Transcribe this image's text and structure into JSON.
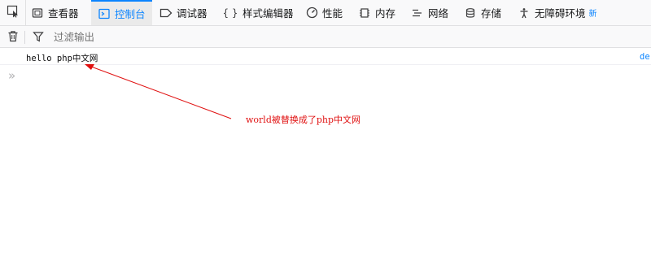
{
  "tabs": [
    {
      "label": "查看器",
      "icon": "inspector-icon"
    },
    {
      "label": "控制台",
      "icon": "console-icon",
      "selected": true
    },
    {
      "label": "调试器",
      "icon": "debugger-icon"
    },
    {
      "label": "样式编辑器",
      "icon": "style-editor-icon"
    },
    {
      "label": "性能",
      "icon": "performance-icon"
    },
    {
      "label": "内存",
      "icon": "memory-icon"
    },
    {
      "label": "网络",
      "icon": "network-icon"
    },
    {
      "label": "存储",
      "icon": "storage-icon"
    },
    {
      "label": "无障碍环境",
      "icon": "accessibility-icon",
      "badge": "新"
    }
  ],
  "toolbar": {
    "filter_placeholder": "过滤输出"
  },
  "console": {
    "message": "hello php中文网",
    "source": "der",
    "prompt_symbol": "»"
  },
  "annotation": {
    "text": "world被替换成了php中文网",
    "color": "#e01010"
  },
  "colors": {
    "accent": "#0a84ff",
    "toolbar_bg": "#f9f9fa"
  }
}
